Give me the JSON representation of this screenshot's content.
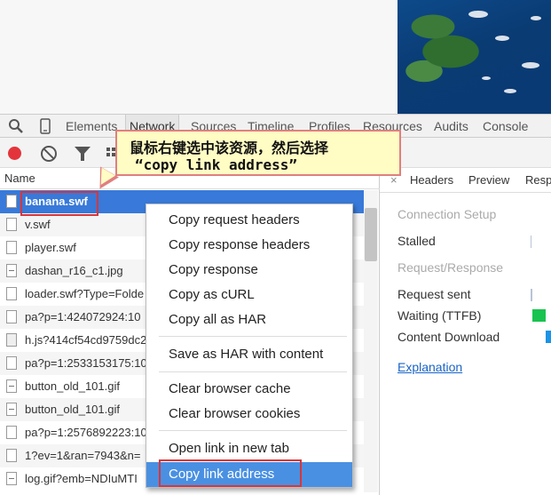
{
  "devtools": {
    "tabs": [
      {
        "label": "Elements"
      },
      {
        "label": "Network",
        "active": true
      },
      {
        "label": "Sources"
      },
      {
        "label": "Timeline"
      },
      {
        "label": "Profiles"
      },
      {
        "label": "Resources"
      },
      {
        "label": "Audits"
      },
      {
        "label": "Console"
      }
    ]
  },
  "request_list": {
    "column_name": "Name",
    "rows": [
      {
        "name": "banana.swf",
        "selected": true,
        "icon": "file-icon"
      },
      {
        "name": "v.swf",
        "icon": "file-icon"
      },
      {
        "name": "player.swf",
        "icon": "file-icon"
      },
      {
        "name": "dashan_r16_c1.jpg",
        "icon": "image-file-icon"
      },
      {
        "name": "loader.swf?Type=Folde",
        "extra": "...",
        "icon": "file-icon"
      },
      {
        "name": "pa?p=1:424072924:10",
        "icon": "file-icon"
      },
      {
        "name": "h.js?414cf54cd9759dc2",
        "icon": "script-file-icon"
      },
      {
        "name": "pa?p=1:2533153175:10",
        "icon": "file-icon"
      },
      {
        "name": "button_old_101.gif",
        "icon": "image-file-icon"
      },
      {
        "name": "button_old_101.gif",
        "icon": "image-file-icon"
      },
      {
        "name": "pa?p=1:2576892223:10",
        "icon": "file-icon"
      },
      {
        "name": "1?ev=1&ran=7943&n=",
        "icon": "file-icon"
      },
      {
        "name": "log.gif?emb=NDIuMTI",
        "icon": "image-file-icon"
      }
    ]
  },
  "detail": {
    "close": "×",
    "tabs": [
      {
        "label": "Headers"
      },
      {
        "label": "Preview"
      },
      {
        "label": "Resp"
      }
    ],
    "lines": [
      {
        "text": "Connection Setup",
        "kind": "section"
      },
      {
        "text": "Stalled",
        "kind": "item"
      },
      {
        "text": "Request/Response",
        "kind": "section"
      },
      {
        "text": "Request sent",
        "kind": "item"
      },
      {
        "text": "Waiting (TTFB)",
        "kind": "item"
      },
      {
        "text": "Content Download",
        "kind": "item"
      },
      {
        "text": "Explanation",
        "kind": "link"
      }
    ],
    "colors": {
      "waiting": "#19c34f",
      "download": "#1b93e6",
      "marker": "#b8c4d6"
    }
  },
  "context_menu": {
    "items": [
      {
        "label": "Copy request headers"
      },
      {
        "label": "Copy response headers"
      },
      {
        "label": "Copy response"
      },
      {
        "label": "Copy as cURL"
      },
      {
        "label": "Copy all as HAR"
      },
      {
        "label": "Save as HAR with content"
      },
      {
        "label": "Clear browser cache"
      },
      {
        "label": "Clear browser cookies"
      },
      {
        "label": "Open link in new tab"
      },
      {
        "label": "Copy link address",
        "highlight": true
      }
    ]
  },
  "annotation": {
    "line1": "鼠标右键选中该资源，然后选择",
    "line2": "“copy link address”",
    "colors": {
      "fill": "#fffcc4",
      "border": "#e07f7f",
      "highlight_box": "#d7363c"
    }
  }
}
